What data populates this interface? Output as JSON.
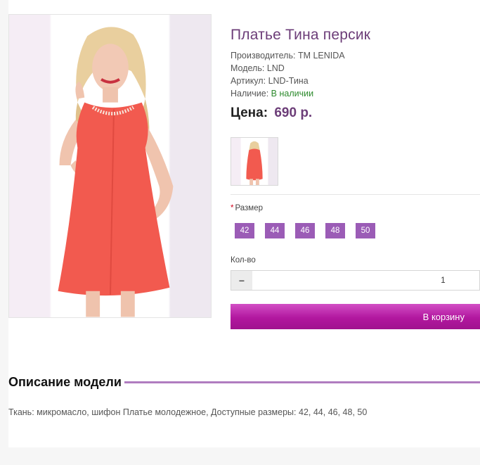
{
  "product": {
    "title": "Платье Тина персик",
    "manufacturer_label": "Производитель:",
    "manufacturer_value": "TM LENIDA",
    "model_label": "Модель:",
    "model_value": "LND",
    "sku_label": "Артикул:",
    "sku_value": "LND-Тина",
    "availability_label": "Наличие:",
    "availability_value": "В наличии",
    "price_label": "Цена:",
    "price_value": "690 р."
  },
  "options": {
    "size_required_mark": "*",
    "size_label": "Размер",
    "sizes": [
      "42",
      "44",
      "46",
      "48",
      "50"
    ]
  },
  "quantity": {
    "label": "Кол-во",
    "minus": "−",
    "value": "1"
  },
  "cart": {
    "button_label": "В корзину"
  },
  "description": {
    "heading": "Описание модели",
    "text": "Ткань: микромасло, шифон Платье молодежное, Доступные размеры: 42, 44, 46, 48, 50"
  },
  "colors": {
    "accent": "#6c3d78",
    "size_button": "#9b5cb6",
    "cart_button": "#b2179f",
    "in_stock": "#2d8a2d",
    "dress": "#f25a4f"
  }
}
